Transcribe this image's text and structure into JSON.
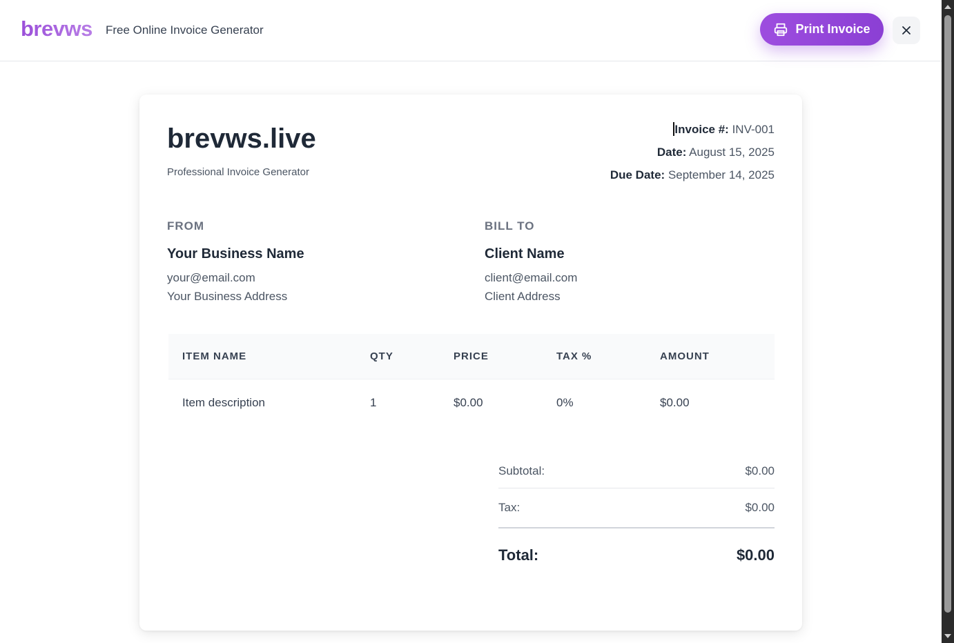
{
  "header": {
    "brand": "brevws",
    "tagline": "Free Online Invoice Generator",
    "print_label": "Print Invoice"
  },
  "invoice": {
    "company": "brevws.live",
    "company_sub": "Professional Invoice Generator",
    "meta": {
      "number_label": "Invoice #:",
      "number": "INV-001",
      "date_label": "Date:",
      "date": "August 15, 2025",
      "due_label": "Due Date:",
      "due": "September 14, 2025"
    },
    "from": {
      "heading": "FROM",
      "name": "Your Business Name",
      "email": "your@email.com",
      "address": "Your Business Address"
    },
    "bill_to": {
      "heading": "BILL TO",
      "name": "Client Name",
      "email": "client@email.com",
      "address": "Client Address"
    },
    "table": {
      "headers": [
        "ITEM NAME",
        "QTY",
        "PRICE",
        "TAX %",
        "AMOUNT"
      ],
      "rows": [
        [
          "Item description",
          "1",
          "$0.00",
          "0%",
          "$0.00"
        ]
      ]
    },
    "totals": {
      "subtotal_label": "Subtotal:",
      "subtotal": "$0.00",
      "tax_label": "Tax:",
      "tax": "$0.00",
      "total_label": "Total:",
      "total": "$0.00"
    }
  },
  "colors": {
    "accent": "#9b4fd9",
    "text_dark": "#1f2937",
    "text_muted": "#4b5563"
  },
  "icons": {
    "print": "printer-icon",
    "close": "close-icon"
  }
}
